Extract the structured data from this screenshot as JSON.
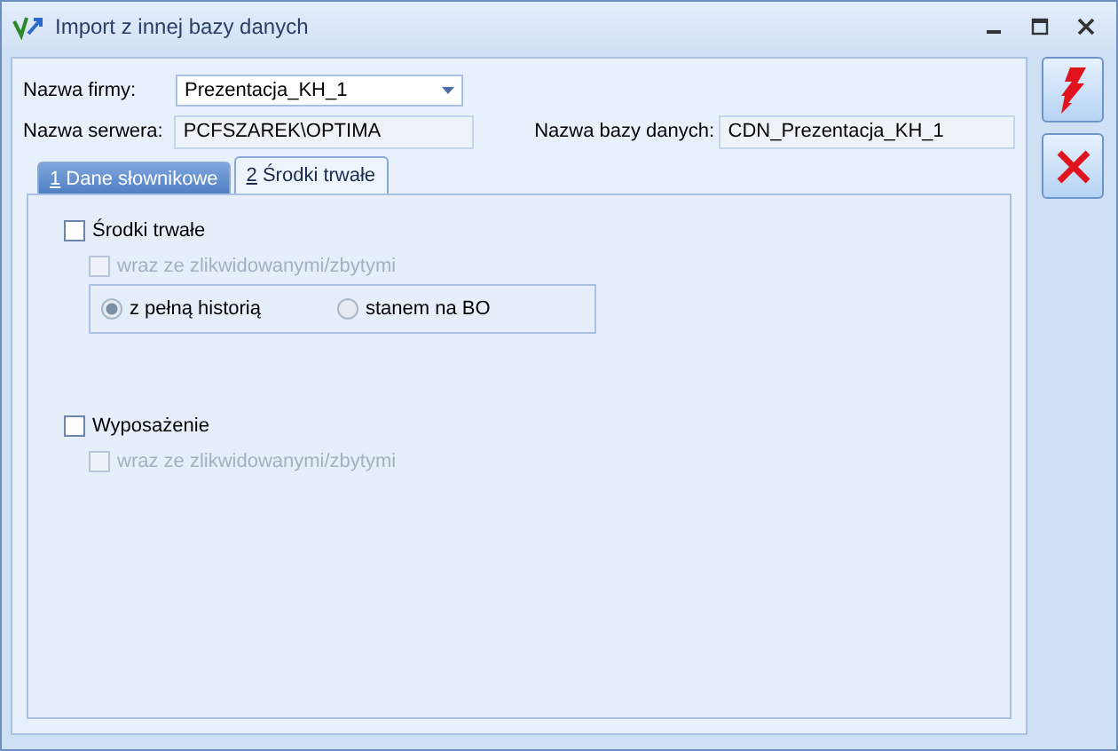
{
  "window": {
    "title": "Import z innej bazy danych"
  },
  "fields": {
    "company": {
      "label": "Nazwa firmy:",
      "value": "Prezentacja_KH_1"
    },
    "server": {
      "label": "Nazwa serwera:",
      "value": "PCFSZAREK\\OPTIMA"
    },
    "database": {
      "label": "Nazwa bazy danych:",
      "value": "CDN_Prezentacja_KH_1"
    }
  },
  "tabs": [
    {
      "key": "1",
      "label": "Dane słownikowe",
      "selected": false
    },
    {
      "key": "2",
      "label": "Środki trwałe",
      "selected": true
    }
  ],
  "sections": [
    {
      "label": "Środki trwałe",
      "checked": false,
      "disabled": false,
      "sub": {
        "label": "wraz ze zlikwidowanymi/zbytymi",
        "checked": false,
        "disabled": true
      },
      "radios": [
        {
          "label": "z pełną historią",
          "selected": true,
          "disabled": true
        },
        {
          "label": "stanem na BO",
          "selected": false,
          "disabled": true
        }
      ]
    },
    {
      "label": "Wyposażenie",
      "checked": false,
      "disabled": false,
      "sub": {
        "label": "wraz ze zlikwidowanymi/zbytymi",
        "checked": false,
        "disabled": true
      }
    }
  ]
}
